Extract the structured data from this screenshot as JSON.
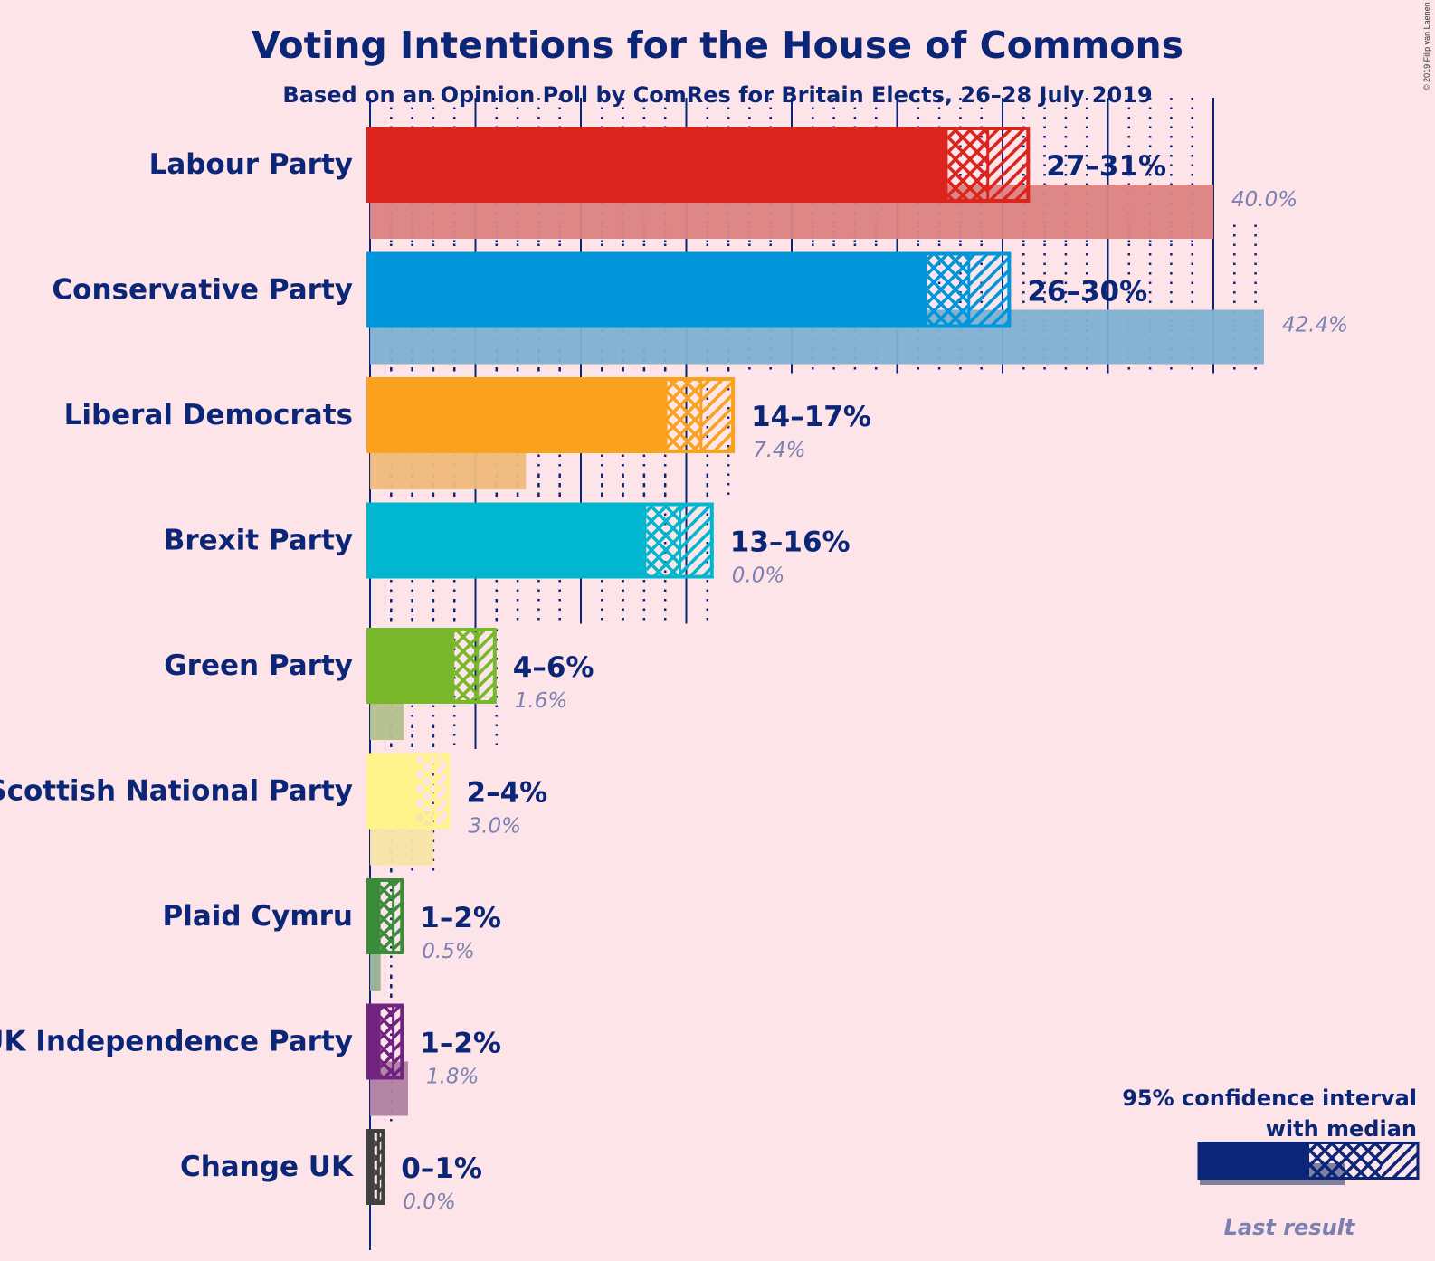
{
  "chart_data": {
    "type": "bar",
    "orientation": "horizontal",
    "title": "Voting Intentions for the House of Commons",
    "subtitle": "Based on an Opinion Poll by ComRes for Britain Elects, 26–28 July 2019",
    "copyright": "© 2019 Filip van Laenen",
    "xlabel": "",
    "ylabel": "",
    "xlim": [
      0,
      43
    ],
    "grid": {
      "major_every": 5,
      "minor_every": 1,
      "major_style": "solid",
      "minor_style": "dotted"
    },
    "text_color": "#0b2577",
    "last_result_text_color": "#7b80b0",
    "parties": [
      {
        "name": "Labour Party",
        "color": "#db241e",
        "last_color": "#dc8282",
        "ci_low": 27.4,
        "median": 29.3,
        "ci_high": 31.3,
        "range_label": "27–31%",
        "last_result": 40.0,
        "last_label": "40.0%"
      },
      {
        "name": "Conservative Party",
        "color": "#0096d9",
        "last_color": "#80b0d0",
        "ci_low": 26.4,
        "median": 28.4,
        "ci_high": 30.4,
        "range_label": "26–30%",
        "last_result": 42.4,
        "last_label": "42.4%"
      },
      {
        "name": "Liberal Democrats",
        "color": "#faa11d",
        "last_color": "#f0b97c",
        "ci_low": 14.1,
        "median": 15.7,
        "ci_high": 17.3,
        "range_label": "14–17%",
        "last_result": 7.4,
        "last_label": "7.4%"
      },
      {
        "name": "Brexit Party",
        "color": "#00b7cf",
        "last_color": "#80c8d8",
        "ci_low": 13.1,
        "median": 14.7,
        "ci_high": 16.3,
        "range_label": "13–16%",
        "last_result": 0.0,
        "last_label": "0.0%"
      },
      {
        "name": "Green Party",
        "color": "#78b82a",
        "last_color": "#b4c08c",
        "ci_low": 4.0,
        "median": 5.1,
        "ci_high": 6.0,
        "range_label": "4–6%",
        "last_result": 1.6,
        "last_label": "1.6%"
      },
      {
        "name": "Scottish National Party",
        "color": "#fff48c",
        "last_color": "#f8e4a4",
        "ci_low": 2.2,
        "median": 3.1,
        "ci_high": 3.8,
        "range_label": "2–4%",
        "last_result": 3.0,
        "last_label": "3.0%"
      },
      {
        "name": "Plaid Cymru",
        "color": "#3a8c3a",
        "last_color": "#98b090",
        "ci_low": 0.5,
        "median": 1.1,
        "ci_high": 1.6,
        "range_label": "1–2%",
        "last_result": 0.5,
        "last_label": "0.5%"
      },
      {
        "name": "UK Independence Party",
        "color": "#70247f",
        "last_color": "#b080a0",
        "ci_low": 0.5,
        "median": 1.1,
        "ci_high": 1.6,
        "range_label": "1–2%",
        "last_result": 1.8,
        "last_label": "1.8%"
      },
      {
        "name": "Change UK",
        "color": "#404040",
        "last_color": "#909090",
        "ci_low": 0.2,
        "median": 0.4,
        "ci_high": 0.7,
        "range_label": "0–1%",
        "last_result": 0.0,
        "last_label": "0.0%"
      }
    ],
    "legend": {
      "placement": "bottom-right",
      "line1": "95% confidence interval",
      "line2": "with median",
      "last_result_label": "Last result",
      "color": "#0b2577",
      "last_color": "#8080a0"
    }
  }
}
